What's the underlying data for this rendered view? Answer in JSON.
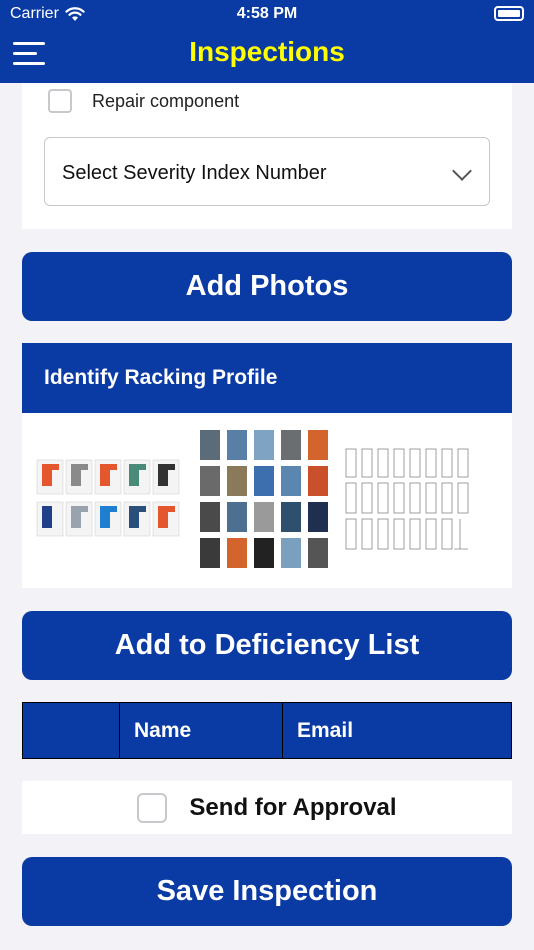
{
  "status_bar": {
    "carrier": "Carrier",
    "time": "4:58 PM"
  },
  "nav": {
    "title": "Inspections",
    "menu_icon": "hamburger-menu-icon",
    "title_color": "#ffff00",
    "bar_color": "#0a3aa3"
  },
  "repair": {
    "label": "Repair component",
    "checked": false
  },
  "severity_select": {
    "value": "Select Severity Index Number",
    "icon": "chevron-down-icon"
  },
  "buttons": {
    "add_photos": "Add Photos",
    "add_deficiency": "Add to Deficiency List",
    "save_inspection": "Save Inspection"
  },
  "racking_profile": {
    "title": "Identify Racking Profile",
    "thumbnails": [
      "racking-profile-colored-thumbnail",
      "racking-profile-grid-thumbnail",
      "racking-profile-sketch-thumbnail"
    ]
  },
  "table": {
    "headers": [
      "",
      "Name",
      "Email"
    ]
  },
  "approval": {
    "label": "Send for Approval",
    "checked": false
  }
}
